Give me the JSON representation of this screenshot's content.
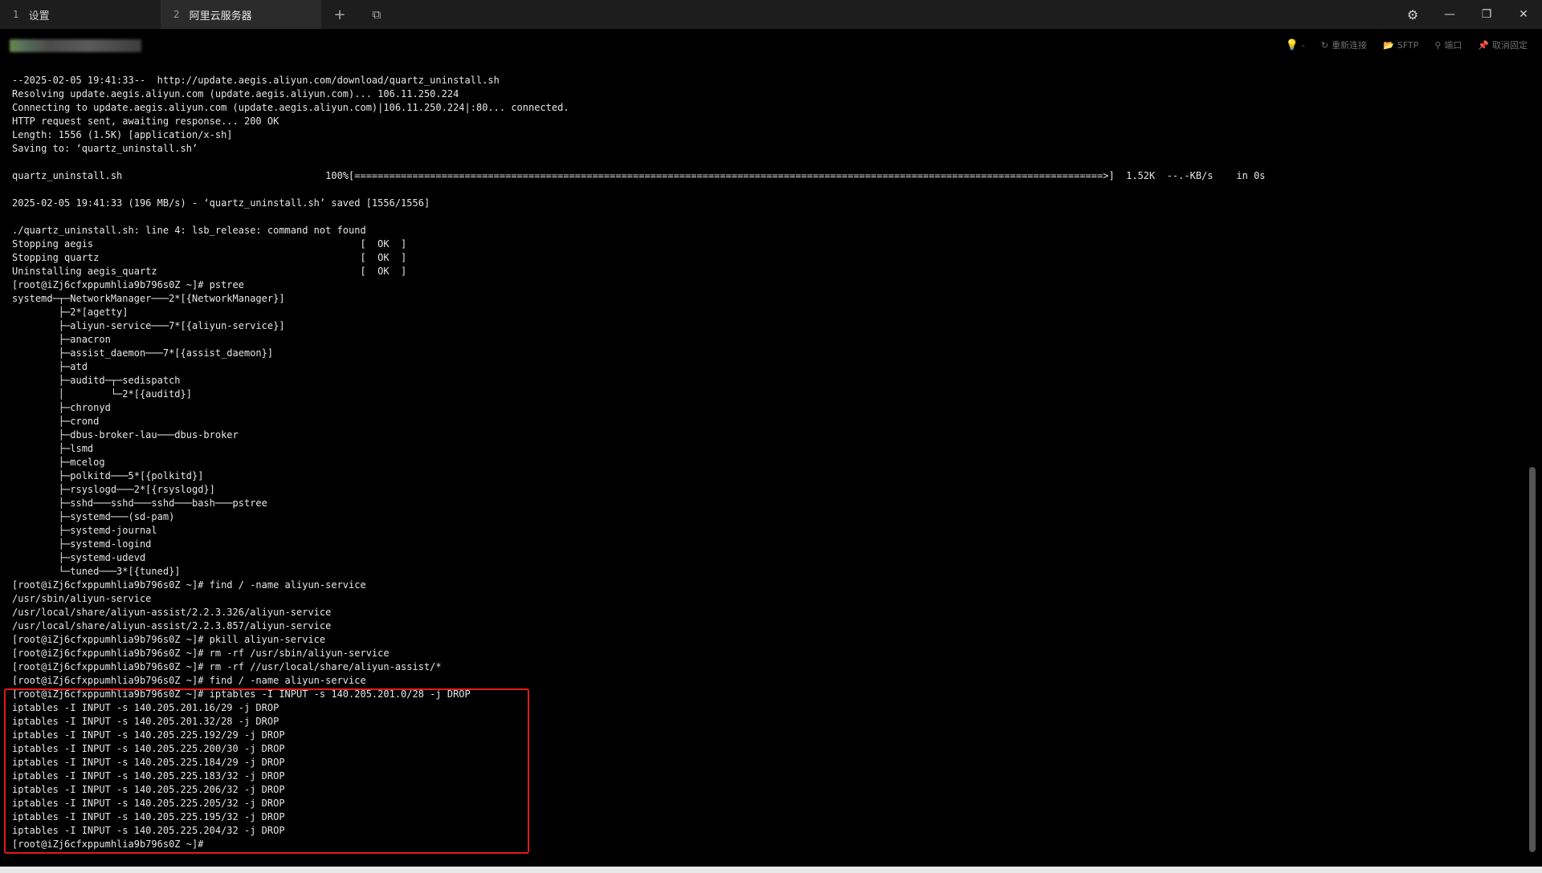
{
  "tabs": [
    {
      "num": "1",
      "label": "设置"
    },
    {
      "num": "2",
      "label": "阿里云服务器"
    }
  ],
  "tab_controls": {
    "add_icon": "plus-icon",
    "add_glyph": "+",
    "window_icon": "window-icon",
    "window_glyph": "⧉"
  },
  "window_controls": {
    "settings_glyph": "⚙",
    "minimize_glyph": "—",
    "maximize_glyph": "❐",
    "close_glyph": "✕"
  },
  "toolbar": {
    "bulb_glyph": "💡",
    "bulb_suffix": "-",
    "reconnect_glyph": "↻",
    "reconnect_label": "重新连接",
    "sftp_glyph": "📂",
    "sftp_label": "SFTP",
    "port_glyph": "⚲",
    "port_label": "端口",
    "unpin_glyph": "📌",
    "unpin_label": "取消固定"
  },
  "terminal_lines": [
    "--2025-02-05 19:41:33--  http://update.aegis.aliyun.com/download/quartz_uninstall.sh",
    "Resolving update.aegis.aliyun.com (update.aegis.aliyun.com)... 106.11.250.224",
    "Connecting to update.aegis.aliyun.com (update.aegis.aliyun.com)|106.11.250.224|:80... connected.",
    "HTTP request sent, awaiting response... 200 OK",
    "Length: 1556 (1.5K) [application/x-sh]",
    "Saving to: ‘quartz_uninstall.sh’",
    "",
    "quartz_uninstall.sh                                   100%[=================================================================================================================================>]  1.52K  --.-KB/s    in 0s",
    "",
    "2025-02-05 19:41:33 (196 MB/s) - ‘quartz_uninstall.sh’ saved [1556/1556]",
    "",
    "./quartz_uninstall.sh: line 4: lsb_release: command not found",
    "Stopping aegis                                              [  OK  ]",
    "Stopping quartz                                             [  OK  ]",
    "Uninstalling aegis_quartz                                   [  OK  ]",
    "[root@iZj6cfxppumhlia9b796s0Z ~]# pstree",
    "systemd─┬─NetworkManager───2*[{NetworkManager}]",
    "        ├─2*[agetty]",
    "        ├─aliyun-service───7*[{aliyun-service}]",
    "        ├─anacron",
    "        ├─assist_daemon───7*[{assist_daemon}]",
    "        ├─atd",
    "        ├─auditd─┬─sedispatch",
    "        │        └─2*[{auditd}]",
    "        ├─chronyd",
    "        ├─crond",
    "        ├─dbus-broker-lau───dbus-broker",
    "        ├─lsmd",
    "        ├─mcelog",
    "        ├─polkitd───5*[{polkitd}]",
    "        ├─rsyslogd───2*[{rsyslogd}]",
    "        ├─sshd───sshd───sshd───bash───pstree",
    "        ├─systemd───(sd-pam)",
    "        ├─systemd-journal",
    "        ├─systemd-logind",
    "        ├─systemd-udevd",
    "        └─tuned───3*[{tuned}]",
    "[root@iZj6cfxppumhlia9b796s0Z ~]# find / -name aliyun-service",
    "/usr/sbin/aliyun-service",
    "/usr/local/share/aliyun-assist/2.2.3.326/aliyun-service",
    "/usr/local/share/aliyun-assist/2.2.3.857/aliyun-service",
    "[root@iZj6cfxppumhlia9b796s0Z ~]# pkill aliyun-service",
    "[root@iZj6cfxppumhlia9b796s0Z ~]# rm -rf /usr/sbin/aliyun-service",
    "[root@iZj6cfxppumhlia9b796s0Z ~]# rm -rf //usr/local/share/aliyun-assist/*",
    "[root@iZj6cfxppumhlia9b796s0Z ~]# find / -name aliyun-service",
    "[root@iZj6cfxppumhlia9b796s0Z ~]# iptables -I INPUT -s 140.205.201.0/28 -j DROP",
    "iptables -I INPUT -s 140.205.201.16/29 -j DROP",
    "iptables -I INPUT -s 140.205.201.32/28 -j DROP",
    "iptables -I INPUT -s 140.205.225.192/29 -j DROP",
    "iptables -I INPUT -s 140.205.225.200/30 -j DROP",
    "iptables -I INPUT -s 140.205.225.184/29 -j DROP",
    "iptables -I INPUT -s 140.205.225.183/32 -j DROP",
    "iptables -I INPUT -s 140.205.225.206/32 -j DROP",
    "iptables -I INPUT -s 140.205.225.205/32 -j DROP",
    "iptables -I INPUT -s 140.205.225.195/32 -j DROP",
    "iptables -I INPUT -s 140.205.225.204/32 -j DROP",
    "[root@iZj6cfxppumhlia9b796s0Z ~]# "
  ],
  "colors": {
    "background": "#000000",
    "text": "#e6e6e6",
    "highlight_border": "#e21b1b",
    "tabbar": "#1d1d1d",
    "active_tab": "#2b2b2b"
  }
}
